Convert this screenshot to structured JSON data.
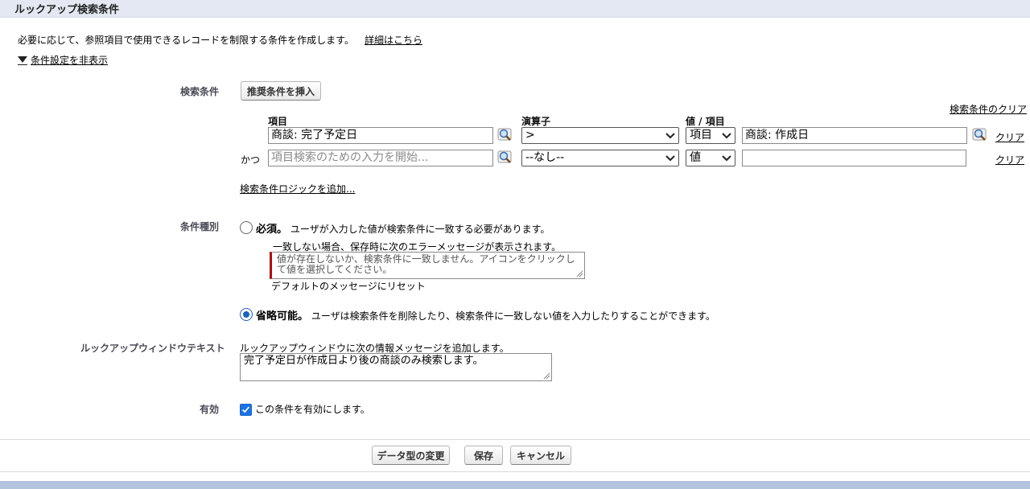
{
  "section": {
    "title": "ルックアップ検索条件"
  },
  "intro": {
    "text": "必要に応じて、参照項目で使用できるレコードを制限する条件を作成します。",
    "details_link": "詳細はこちら",
    "toggle_label": "条件設定を非表示"
  },
  "criteria": {
    "label": "検索条件",
    "insert_suggested_button": "推奨条件を挿入",
    "clear_all_link": "検索条件のクリア",
    "col_field": "項目",
    "col_operator": "演算子",
    "col_value": "値 / 項目",
    "rows": [
      {
        "prefix": "",
        "field_value": "商談: 完了予定日",
        "operator": ">",
        "value_type": "項目",
        "value_value": "商談: 作成日",
        "clear": "クリア"
      },
      {
        "prefix": "かつ",
        "field_placeholder": "項目検索のための入力を開始...",
        "operator": "--なし--",
        "value_type": "値",
        "value_value": "",
        "clear": "クリア"
      }
    ],
    "add_logic_link": "検索条件ロジックを追加..."
  },
  "filter_type": {
    "label": "条件種別",
    "required": {
      "title": "必須。",
      "desc": "ユーザが入力した値が検索条件に一致する必要があります。",
      "checked": false
    },
    "error_intro": "一致しない場合、保存時に次のエラーメッセージが表示されます。",
    "error_message": "値が存在しないか、検索条件に一致しません。アイコンをクリックして値を選択してください。",
    "reset_default": "デフォルトのメッセージにリセット",
    "optional": {
      "title": "省略可能。",
      "desc": "ユーザは検索条件を削除したり、検索条件に一致しない値を入力したりすることができます。",
      "checked": true
    }
  },
  "window_text": {
    "label": "ルックアップウィンドウテキスト",
    "intro": "ルックアップウィンドウに次の情報メッセージを追加します。",
    "value": "完了予定日が作成日より後の商談のみ検索します。"
  },
  "active": {
    "label": "有効",
    "checkbox_label": "この条件を有効にします。",
    "checked": true
  },
  "footer": {
    "change_type_button": "データ型の変更",
    "save_button": "保存",
    "cancel_button": "キャンセル"
  },
  "colors": {
    "header_bg": "#e3e8f2",
    "error_bar": "#c00000",
    "radio_blue": "#1f5fbf",
    "checkbox_blue": "#1a73e8",
    "bottom_bar": "#b3c3dd"
  }
}
